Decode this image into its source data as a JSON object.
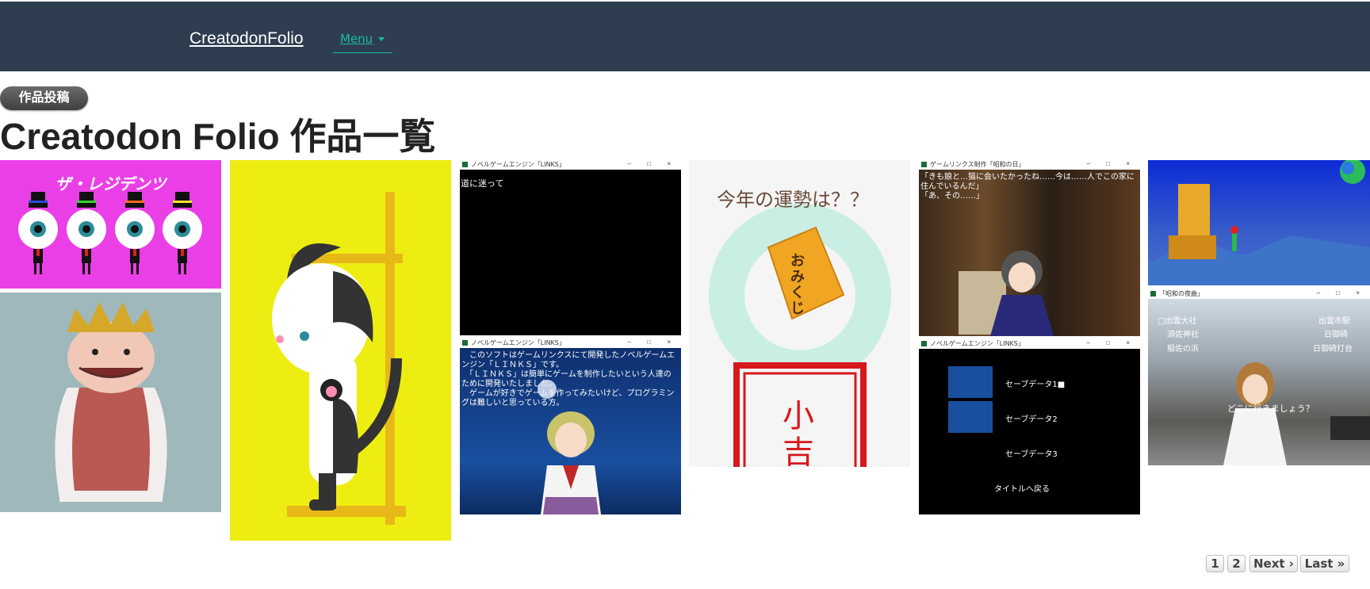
{
  "navbar": {
    "brand": "CreatodonFolio",
    "menu_label": "Menu"
  },
  "post_button": "作品投稿",
  "page_title": "Creatodon Folio 作品一覧",
  "gallery": {
    "residents": {
      "title": "ザ・レジデンツ"
    },
    "window_title": "ノベルゲームエンジン「LINKS」",
    "window_buttons": "– □ ×",
    "novel_line": "道に迷って",
    "novel_intro": "　このソフトはゲームリンクスにて開発したノベルゲームエンジン「ＬＩＮＫＳ」です。\n　「ＬＩＮＫＳ」は簡単にゲームを制作したいという人達のために開発いたしました。\n　ゲームが好きでゲームを作ってみたいけど、プログラミングは難しいと思っている方。",
    "omikuji": {
      "question": "今年の運勢は？？",
      "can_label": "おみくじ",
      "result": "小吉"
    },
    "library": {
      "window_title": "ゲームリンクス制作「昭和の日」",
      "dialog": "「きも娘と…猫に会いたかったね……今は……人でこの家に住んでいるんだ」\n「あ、その……」"
    },
    "save_menu": {
      "items": [
        "セーブデータ1■",
        "セーブデータ2",
        "セーブデータ3"
      ],
      "back": "タイトルへ戻る"
    },
    "street": {
      "window_title": "「昭和の夜曲」",
      "options_left": [
        "□出雲大社",
        "須佐神社",
        "稲佐の浜"
      ],
      "options_right": [
        "出雲市駅",
        "日御碕",
        "日御碕灯台"
      ],
      "dialog": "どこに行きましょう？"
    }
  },
  "pagination": {
    "pages": [
      "1",
      "2"
    ],
    "next": "Next ›",
    "last": "Last »"
  },
  "colors": {
    "navbar_bg": "#2e3e50",
    "accent": "#1abc9c",
    "title_text": "#222222"
  }
}
